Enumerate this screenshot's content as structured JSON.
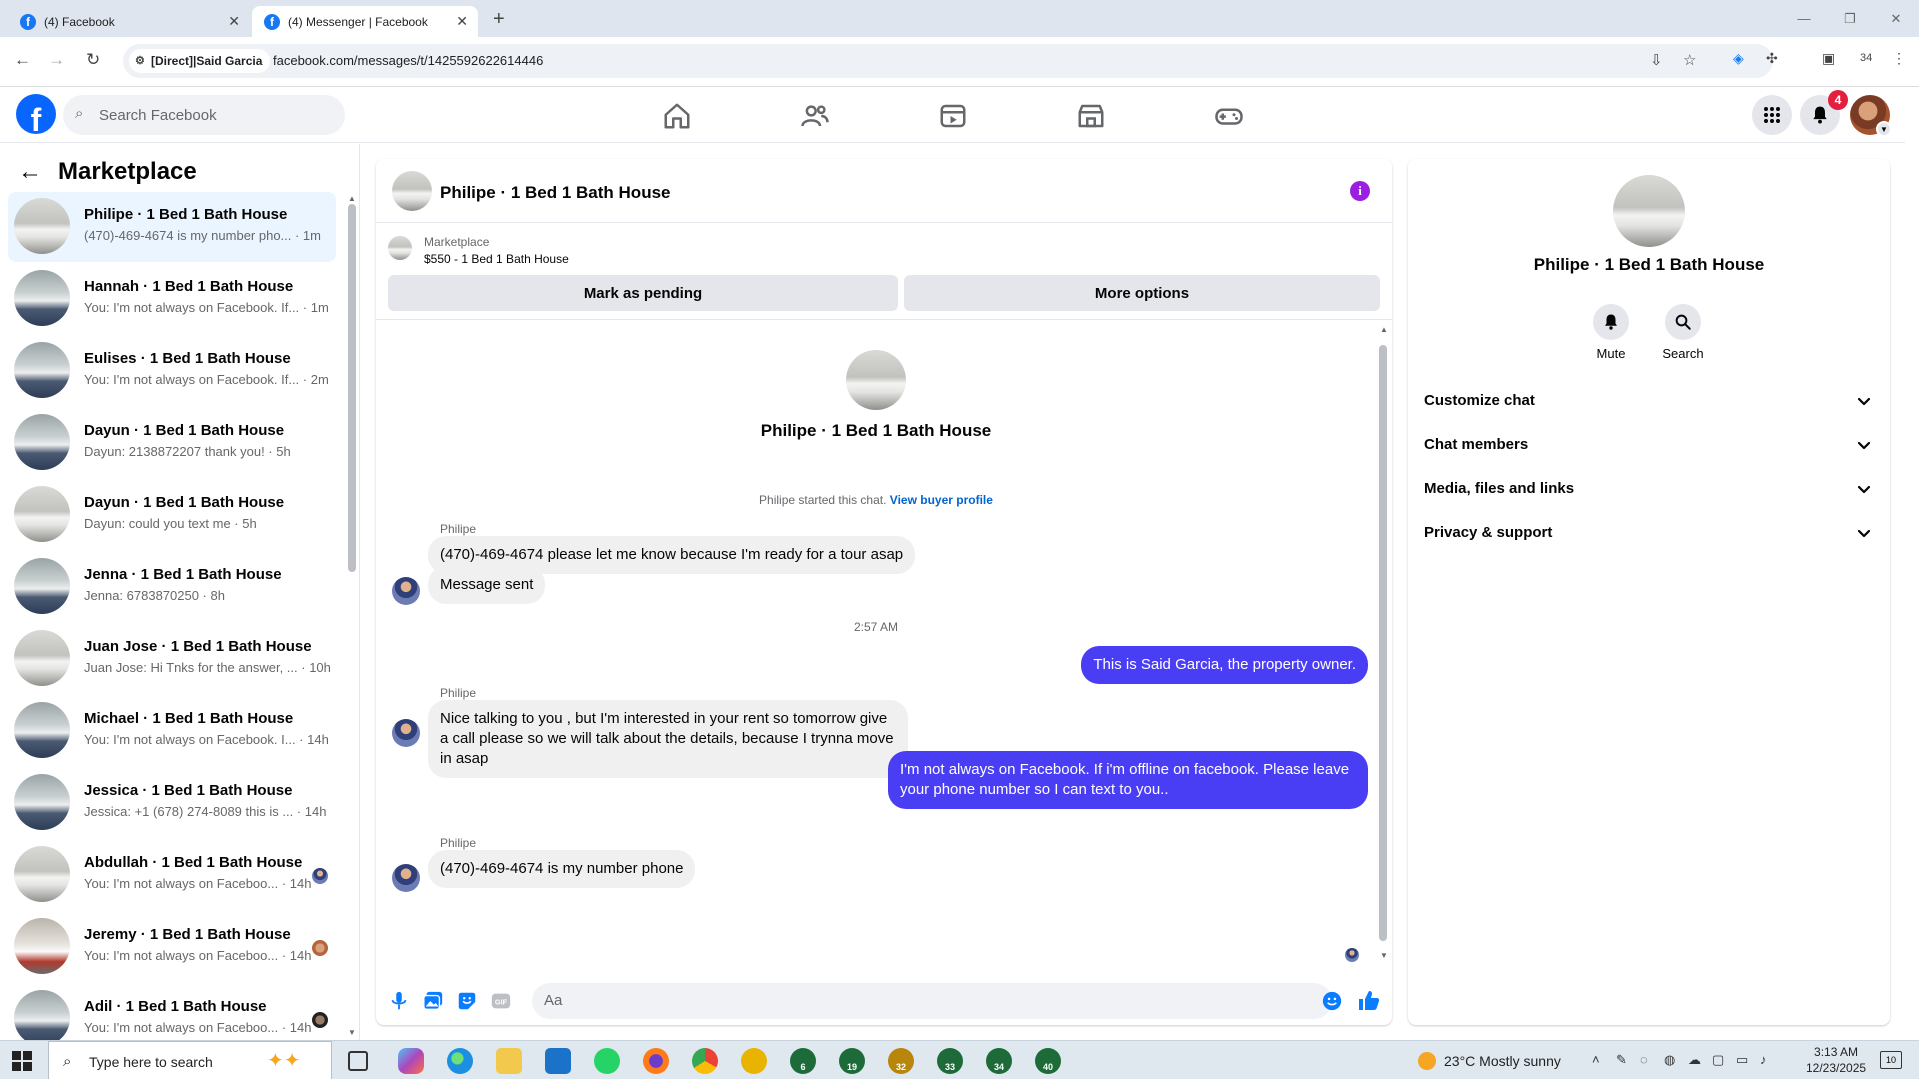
{
  "browser": {
    "tabs": [
      {
        "title": "(4) Facebook"
      },
      {
        "title": "(4) Messenger | Facebook"
      }
    ],
    "site_chip": "[Direct]|Said Garcia",
    "url": "facebook.com/messages/t/1425592622614446",
    "extension_badge": "34"
  },
  "fb_header": {
    "search_placeholder": "Search Facebook",
    "notifications_count": "4"
  },
  "left_panel": {
    "title": "Marketplace",
    "conversations": [
      {
        "name": "Philipe · 1 Bed 1 Bath House",
        "preview": "(470)-469-4674 is my number pho... · 1m",
        "active": true
      },
      {
        "name": "Hannah · 1 Bed 1 Bath House",
        "preview": "You: I'm not always on Facebook. If... · 1m"
      },
      {
        "name": "Eulises · 1 Bed 1 Bath House",
        "preview": "You: I'm not always on Facebook. If... · 2m"
      },
      {
        "name": "Dayun · 1 Bed 1 Bath House",
        "preview": "Dayun: 2138872207 thank you! · 5h"
      },
      {
        "name": "Dayun · 1 Bed 1 Bath House",
        "preview": "Dayun: could you text me · 5h"
      },
      {
        "name": "Jenna · 1 Bed 1 Bath House",
        "preview": "Jenna: 6783870250 · 8h"
      },
      {
        "name": "Juan Jose · 1 Bed 1 Bath House",
        "preview": "Juan Jose: Hi Tnks for the answer, ... · 10h"
      },
      {
        "name": "Michael · 1 Bed 1 Bath House",
        "preview": "You: I'm not always on Facebook. I... · 14h"
      },
      {
        "name": "Jessica · 1 Bed 1 Bath House",
        "preview": "Jessica: +1 (678) 274-8089 this is ... · 14h"
      },
      {
        "name": "Abdullah · 1 Bed 1 Bath House",
        "preview": "You: I'm not always on Faceboo... · 14h"
      },
      {
        "name": "Jeremy · 1 Bed 1 Bath House",
        "preview": "You: I'm not always on Faceboo... · 14h"
      },
      {
        "name": "Adil · 1 Bed 1 Bath House",
        "preview": "You: I'm not always on Faceboo... · 14h"
      }
    ]
  },
  "chat": {
    "header_name": "Philipe · 1 Bed 1 Bath House",
    "listing_label": "Marketplace",
    "listing_price": "$550 - 1 Bed 1 Bath House",
    "mark_pending": "Mark as pending",
    "more_options": "More options",
    "center_name": "Philipe · 1 Bed 1 Bath House",
    "system_text": "Philipe started this chat.",
    "system_link": "View buyer profile",
    "sender_1": "Philipe",
    "msg_1": "(470)-469-4674 please let me know because I'm ready for a tour asap",
    "msg_2": "Message sent",
    "timestamp": "2:57 AM",
    "msg_3": "This is Said Garcia, the property owner.",
    "sender_2": "Philipe",
    "msg_4": "Nice talking to you , but I'm interested in your rent so tomorrow give a call please so we will talk about the details,  because I trynna move in asap",
    "msg_5": "I'm not always on Facebook. If i'm offline on facebook. Please leave your phone number so I can text to you..",
    "sender_3": "Philipe",
    "msg_6": "(470)-469-4674 is my number phone",
    "composer_placeholder": "Aa"
  },
  "right_panel": {
    "name": "Philipe · 1 Bed 1 Bath House",
    "mute": "Mute",
    "search": "Search",
    "rows": [
      "Customize chat",
      "Chat members",
      "Media, files and links",
      "Privacy & support"
    ]
  },
  "taskbar": {
    "search_placeholder": "Type here to search",
    "weather": "23°C  Mostly sunny",
    "time": "3:13 AM",
    "date": "12/23/2025",
    "notifications": "10",
    "pinned_numbers": [
      "6",
      "19",
      "32",
      "33",
      "34",
      "40"
    ]
  },
  "colors": {
    "facebook_blue": "#0866ff",
    "outgoing_bubble": "#4a3ef5",
    "active_row": "#ebf5ff"
  }
}
